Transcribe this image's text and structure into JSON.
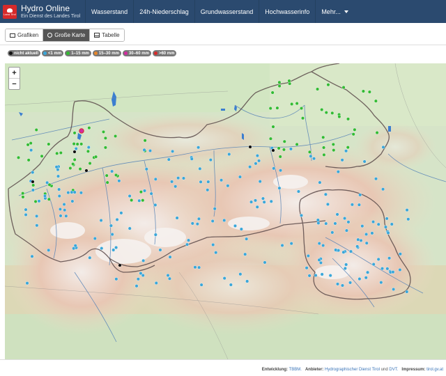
{
  "brand": {
    "title": "Hydro Online",
    "subtitle": "Ein Dienst des Landes Tirol",
    "logo_text": "Land Tirol"
  },
  "nav": {
    "items": [
      "Wasserstand",
      "24h-Niederschlag",
      "Grundwasserstand",
      "Hochwasserinfo",
      "Mehr..."
    ]
  },
  "tabs": [
    {
      "label": "Grafiken",
      "icon": "image-icon",
      "active": false
    },
    {
      "label": "Große Karte",
      "icon": "globe-icon",
      "active": true
    },
    {
      "label": "Tabelle",
      "icon": "table-icon",
      "active": false
    }
  ],
  "legend": [
    {
      "label": "nicht aktuell",
      "color": "#111111"
    },
    {
      "label": "<1 mm",
      "color": "#3aa6d8"
    },
    {
      "label": "1–15 mm",
      "color": "#33bb33"
    },
    {
      "label": "15–30 mm",
      "color": "#e8872a"
    },
    {
      "label": "30–60 mm",
      "color": "#d42aa0"
    },
    {
      "label": ">60 mm",
      "color": "#d82a2a"
    }
  ],
  "map": {
    "zoom_in": "+",
    "zoom_out": "−"
  },
  "footer": {
    "dev_label": "Entwicklung:",
    "dev_value": "TBBM.",
    "provider_label": "Anbieter:",
    "provider_value": "Hydrographischer Dienst Tirol",
    "and": "und",
    "provider_value2": "DVT.",
    "impressum_label": "Impressum:",
    "impressum_value": "tirol.gv.at"
  }
}
